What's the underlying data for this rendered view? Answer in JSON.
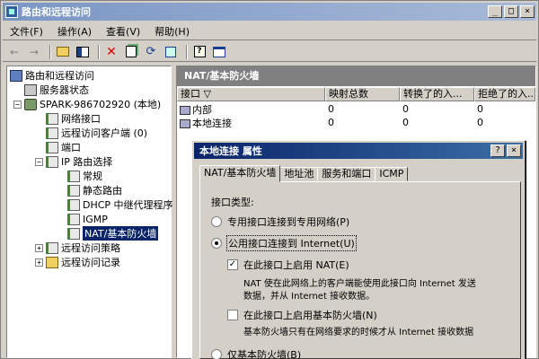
{
  "window": {
    "title": "路由和远程访问"
  },
  "menu": [
    {
      "label": "文件(F)"
    },
    {
      "label": "操作(A)"
    },
    {
      "label": "查看(V)"
    },
    {
      "label": "帮助(H)"
    }
  ],
  "toolbar": {
    "back_icon": "←",
    "forward_icon": "→"
  },
  "tree": {
    "root": "路由和远程访问",
    "server_status": "服务器状态",
    "server": "SPARK-986702920 (本地)",
    "network_interfaces": "网络接口",
    "remote_clients": "远程访问客户端 (0)",
    "ports": "端口",
    "ip_routing": "IP 路由选择",
    "general": "常规",
    "static_routes": "静态路由",
    "dhcp_relay": "DHCP 中继代理程序",
    "igmp": "IGMP",
    "nat": "NAT/基本防火墙",
    "remote_policy": "远程访问策略",
    "remote_logging": "远程访问记录"
  },
  "right": {
    "header": "NAT/基本防火墙",
    "columns": [
      "接口 ▽",
      "映射总数",
      "转换了的入...",
      "拒绝了的入..."
    ],
    "rows": [
      {
        "name": "内部",
        "c1": "0",
        "c2": "0",
        "c3": "0"
      },
      {
        "name": "本地连接",
        "c1": "0",
        "c2": "0",
        "c3": "0"
      }
    ]
  },
  "dialog": {
    "title": "本地连接 属性",
    "help_btn": "?",
    "close_btn": "×",
    "tabs": [
      "NAT/基本防火墙",
      "地址池",
      "服务和端口",
      "ICMP"
    ],
    "interface_type_label": "接口类型:",
    "opt_private": "专用接口连接到专用网络(P)",
    "opt_public": "公用接口连接到 Internet(U)",
    "chk_nat": "在此接口上启用 NAT(E)",
    "nat_desc_1": "NAT 使在此网络上的客户端能使用此接口向 Internet 发送",
    "nat_desc_2": "数据，并从 Internet 接收数据。",
    "chk_fw": "在此接口上启用基本防火墙(N)",
    "fw_desc": "基本防火墙只有在网络要求的时候才从 Internet 接收数据",
    "opt_fw_only": "仅基本防火墙(B)"
  }
}
